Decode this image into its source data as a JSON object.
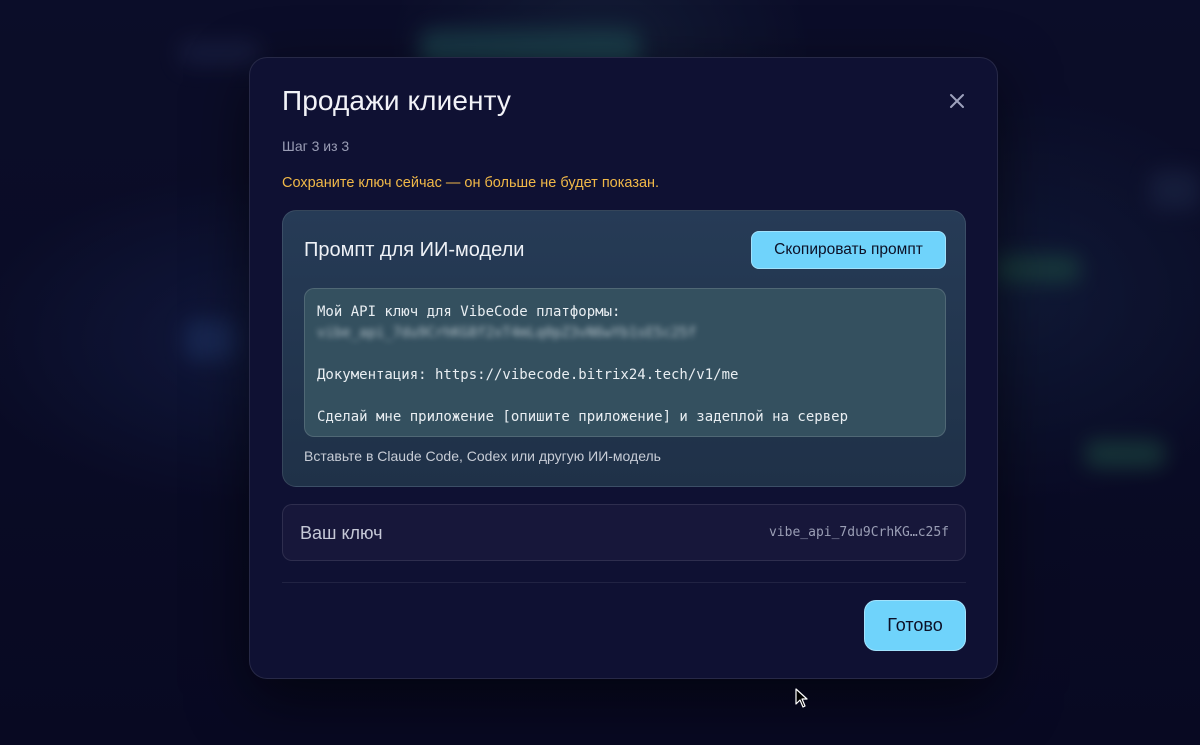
{
  "modal": {
    "title": "Продажи клиенту",
    "step": "Шаг 3 из 3",
    "warning": "Сохраните ключ сейчас — он больше не будет показан.",
    "close_icon": "close-icon"
  },
  "prompt_card": {
    "title": "Промпт для ИИ-модели",
    "copy_button": "Скопировать промпт",
    "lines": [
      "Мой API ключ для VibeCode платформы:",
      "vibe_api_7du9CrhKG8f2xT4mLq0pZ3vN6wYb1sE5c25f",
      "",
      "Документация: https://vibecode.bitrix24.tech/v1/me",
      "",
      "Сделай мне приложение [опишите приложение] и задеплой на сервер"
    ],
    "hint": "Вставьте в Claude Code, Codex или другую ИИ-модель"
  },
  "key_row": {
    "label": "Ваш ключ",
    "value": "vibe_api_7du9CrhKG…c25f"
  },
  "footer": {
    "done_button": "Готово"
  },
  "colors": {
    "accent": "#6fd3fb",
    "warning": "#f0b848",
    "modal_bg": "#0f1133",
    "card_bg": "#263b56"
  }
}
